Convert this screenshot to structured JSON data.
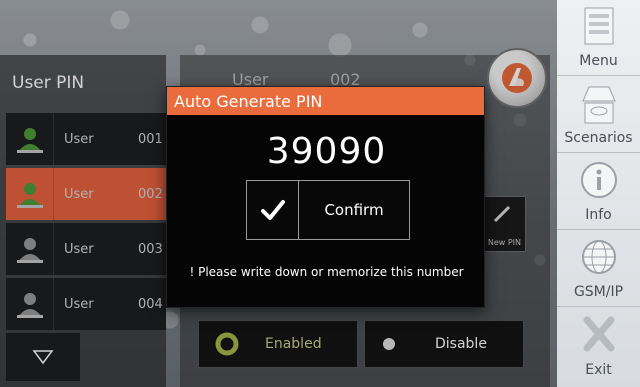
{
  "left_panel": {
    "title": "User PIN",
    "users": [
      {
        "label": "User",
        "number": "001",
        "selected": false,
        "avatar_color": "#4f9a3c"
      },
      {
        "label": "User",
        "number": "002",
        "selected": true,
        "avatar_color": "#4f9a3c"
      },
      {
        "label": "User",
        "number": "003",
        "selected": false,
        "avatar_color": "#9a9a9a"
      },
      {
        "label": "User",
        "number": "004",
        "selected": false,
        "avatar_color": "#9a9a9a"
      }
    ],
    "scroll_icon": "triangle-down-icon"
  },
  "detail_panel": {
    "header_label": "User",
    "header_number": "002",
    "new_pin_label": "New PIN",
    "enabled_label": "Enabled",
    "disable_label": "Disable"
  },
  "modal": {
    "title": "Auto Generate PIN",
    "pin": "39090",
    "confirm_label": "Confirm",
    "confirm_icon": "checkmark-icon",
    "note": "! Please write down or memorize this number"
  },
  "nav": {
    "items": [
      {
        "label": "Menu",
        "icon": "menu-list-icon"
      },
      {
        "label": "Scenarios",
        "icon": "scenarios-icon"
      },
      {
        "label": "Info",
        "icon": "info-icon"
      },
      {
        "label": "GSM/IP",
        "icon": "globe-icon"
      },
      {
        "label": "Exit",
        "icon": "exit-x-icon"
      }
    ]
  },
  "colors": {
    "accent": "#ea6b3b",
    "selected_row": "#e8623f",
    "enabled_ring": "#a8b848",
    "panel_dark": "#1e1f22"
  }
}
